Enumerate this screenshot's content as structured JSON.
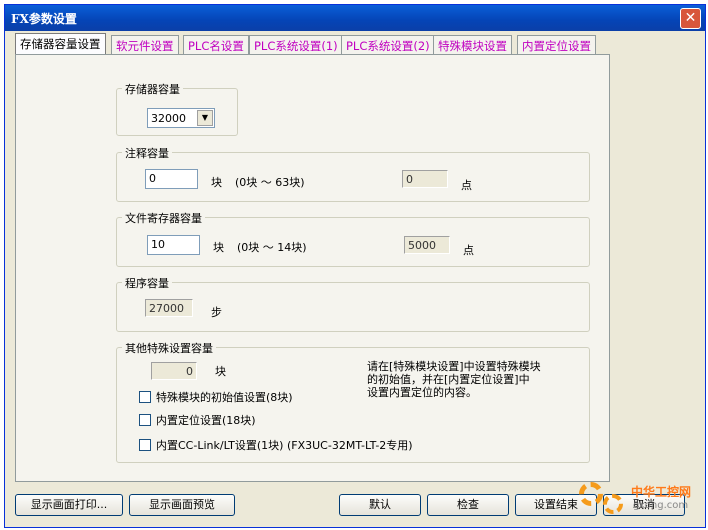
{
  "window": {
    "title": "FX参数设置",
    "close_glyph": "✕"
  },
  "tabs": [
    {
      "label": "存储器容量设置"
    },
    {
      "label": "软元件设置"
    },
    {
      "label": "PLC名设置"
    },
    {
      "label": "PLC系统设置(1)"
    },
    {
      "label": "PLC系统设置(2)"
    },
    {
      "label": "特殊模块设置"
    },
    {
      "label": "内置定位设置"
    }
  ],
  "memory": {
    "label": "存储器容量",
    "value": "32000",
    "dropdown_glyph": "▼"
  },
  "comment": {
    "label": "注释容量",
    "value": "0",
    "unit": "块",
    "range": "(0块 ～ 63块)",
    "points": "0",
    "points_unit": "点"
  },
  "file_register": {
    "label": "文件寄存器容量",
    "value": "10",
    "unit": "块",
    "range": "(0块 ～ 14块)",
    "points": "5000",
    "points_unit": "点"
  },
  "program": {
    "label": "程序容量",
    "value": "27000",
    "unit": "步"
  },
  "special": {
    "label": "其他特殊设置容量",
    "value": "0",
    "unit": "块",
    "note_line1": "请在[特殊模块设置]中设置特殊模块",
    "note_line2": "的初始值，并在[内置定位设置]中",
    "note_line3": "设置内置定位的内容。",
    "checkboxes": [
      {
        "label": "特殊模块的初始值设置(8块)"
      },
      {
        "label": "内置定位设置(18块)"
      },
      {
        "label": "内置CC-Link/LT设置(1块)  (FX3UC-32MT-LT-2专用)"
      }
    ]
  },
  "buttons": {
    "print": "显示画面打印...",
    "preview": "显示画面预览",
    "default": "默认",
    "check": "检查",
    "finish": "设置结束",
    "cancel": "取消"
  },
  "watermark": {
    "text": "中华工控网",
    "sub": "gkong.com"
  }
}
